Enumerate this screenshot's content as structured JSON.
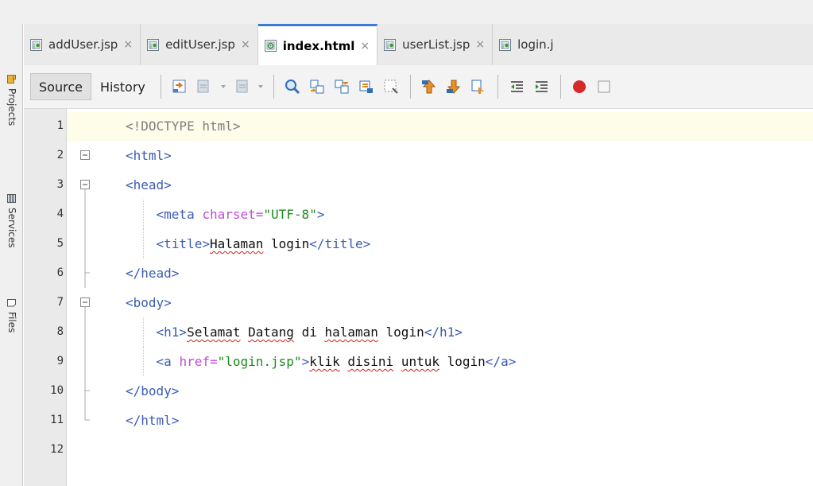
{
  "side_panel": {
    "items": [
      {
        "label": "Projects",
        "icon": "projects-icon"
      },
      {
        "label": "Services",
        "icon": "services-icon"
      },
      {
        "label": "Files",
        "icon": "files-icon"
      }
    ]
  },
  "tabs": [
    {
      "label": "addUser.jsp",
      "close": "×",
      "icon": "jsp-file-icon",
      "active": false
    },
    {
      "label": "editUser.jsp",
      "close": "×",
      "icon": "jsp-file-icon",
      "active": false
    },
    {
      "label": "index.html",
      "close": "×",
      "icon": "html-file-icon",
      "active": true
    },
    {
      "label": "userList.jsp",
      "close": "×",
      "icon": "jsp-file-icon",
      "active": false
    },
    {
      "label": "login.j",
      "close": "",
      "icon": "jsp-file-icon",
      "active": false
    }
  ],
  "toolbar": {
    "source_label": "Source",
    "history_label": "History",
    "icons": [
      "last-edit-icon",
      "back-icon",
      "forward-icon",
      "find-icon",
      "find-previous-icon",
      "find-next-icon",
      "find-selection-icon",
      "toggle-highlight-icon",
      "previous-bookmark-icon",
      "next-bookmark-icon",
      "toggle-bookmark-icon",
      "shift-left-icon",
      "shift-right-icon",
      "record-macro-icon",
      "stop-macro-icon"
    ]
  },
  "code": {
    "lines": [
      {
        "n": "1",
        "parts": [
          {
            "t": "<!DOCTYPE html>",
            "c": "doct"
          }
        ]
      },
      {
        "n": "2",
        "parts": [
          {
            "t": "<html>",
            "c": "tag"
          }
        ]
      },
      {
        "n": "3",
        "parts": [
          {
            "t": "<head>",
            "c": "tag"
          }
        ]
      },
      {
        "n": "4",
        "parts": [
          {
            "t": "    <meta ",
            "c": "tag"
          },
          {
            "t": "charset=",
            "c": "attr"
          },
          {
            "t": "\"UTF-8\"",
            "c": "str"
          },
          {
            "t": ">",
            "c": "tag"
          }
        ]
      },
      {
        "n": "5",
        "parts": [
          {
            "t": "    <title>",
            "c": "tag"
          },
          {
            "t": "Halaman",
            "c": "plain",
            "sq": true
          },
          {
            "t": " login",
            "c": "plain"
          },
          {
            "t": "</title>",
            "c": "tag"
          }
        ]
      },
      {
        "n": "6",
        "parts": [
          {
            "t": "</head>",
            "c": "tag"
          }
        ]
      },
      {
        "n": "7",
        "parts": [
          {
            "t": "<body>",
            "c": "tag"
          }
        ]
      },
      {
        "n": "8",
        "parts": [
          {
            "t": "    <h1>",
            "c": "tag"
          },
          {
            "t": "Selamat",
            "c": "plain",
            "sq": true
          },
          {
            "t": " ",
            "c": "plain"
          },
          {
            "t": "Datang",
            "c": "plain",
            "sq": true
          },
          {
            "t": " di ",
            "c": "plain"
          },
          {
            "t": "halaman",
            "c": "plain",
            "sq": true
          },
          {
            "t": " login",
            "c": "plain"
          },
          {
            "t": "</h1>",
            "c": "tag"
          }
        ]
      },
      {
        "n": "9",
        "parts": [
          {
            "t": "    <a ",
            "c": "tag"
          },
          {
            "t": "href=",
            "c": "attr"
          },
          {
            "t": "\"login.jsp\"",
            "c": "str"
          },
          {
            "t": ">",
            "c": "tag"
          },
          {
            "t": "klik",
            "c": "plain",
            "sq": true
          },
          {
            "t": " ",
            "c": "plain"
          },
          {
            "t": "disini",
            "c": "plain",
            "sq": true
          },
          {
            "t": " ",
            "c": "plain"
          },
          {
            "t": "untuk",
            "c": "plain",
            "sq": true
          },
          {
            "t": " login",
            "c": "plain"
          },
          {
            "t": "</a>",
            "c": "tag"
          }
        ]
      },
      {
        "n": "10",
        "parts": [
          {
            "t": "</body>",
            "c": "tag"
          }
        ]
      },
      {
        "n": "11",
        "parts": [
          {
            "t": "</html>",
            "c": "tag"
          }
        ]
      },
      {
        "n": "12",
        "parts": []
      }
    ]
  },
  "colors": {
    "tag": "#3b5bb4",
    "attribute": "#c24ad8",
    "string": "#1f8a1f",
    "doctype": "#7d7d7d",
    "active_tab_accent": "#3a7bd5",
    "current_line": "#fdfde9"
  }
}
